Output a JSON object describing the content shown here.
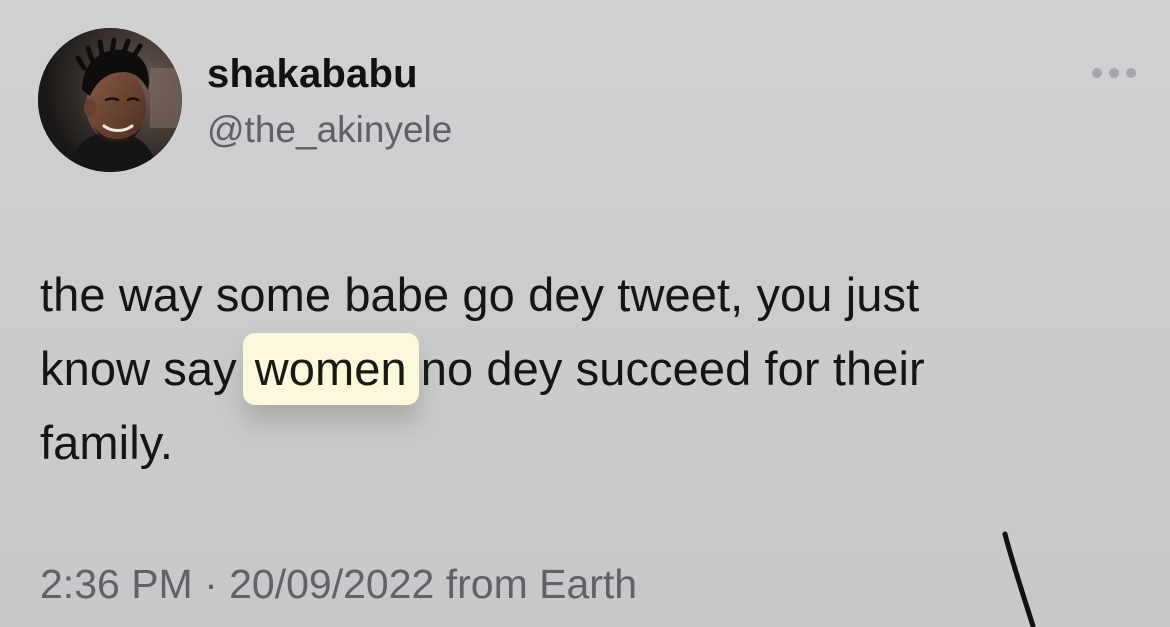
{
  "tweet": {
    "display_name": "shakababu",
    "handle": "@the_akinyele",
    "more_icon": "ellipsis-icon",
    "text": {
      "line1": "the way some babe go dey tweet, you just",
      "line2_before": "know say",
      "line2_highlight": "women",
      "line2_after": "no dey succeed for their",
      "line3": "family."
    },
    "timestamp": "2:36 PM · 20/09/2022 from Earth"
  },
  "colors": {
    "background": "#cdcdcf",
    "highlight": "#fbf8dc",
    "secondary_text": "#5f6267"
  }
}
